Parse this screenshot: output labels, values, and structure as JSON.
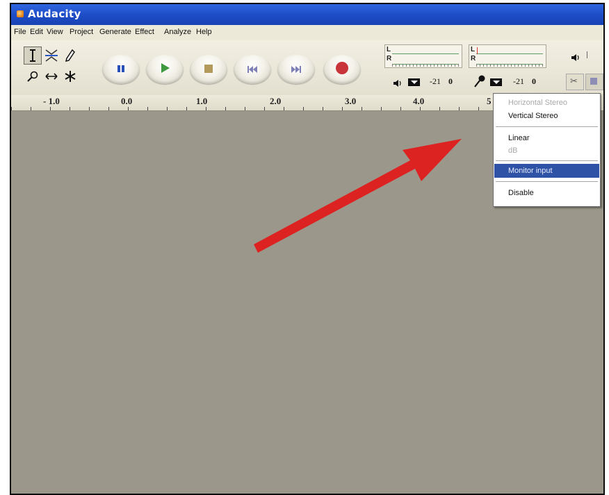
{
  "window": {
    "title": "Audacity"
  },
  "menubar": {
    "items": [
      "File",
      "Edit",
      "View",
      "Project",
      "Generate",
      "Effect",
      "Analyze",
      "Help"
    ]
  },
  "tools": {
    "selection": "selection-tool",
    "envelope": "envelope-tool",
    "draw": "draw-tool",
    "zoom": "zoom-tool",
    "timeshift": "time-shift-tool",
    "multi": "multi-tool"
  },
  "transport": [
    "pause",
    "play",
    "stop",
    "skip-to-start",
    "skip-to-end",
    "record"
  ],
  "meters": {
    "play": {
      "left": "L",
      "right": "R",
      "min": "-21",
      "max": "0"
    },
    "record": {
      "left": "L",
      "right": "R",
      "min": "-21",
      "max": "0"
    }
  },
  "ruler": {
    "labels": [
      "- 1.0",
      "0.0",
      "1.0",
      "2.0",
      "3.0",
      "4.0",
      "5"
    ]
  },
  "meter_menu": {
    "items": [
      {
        "label": "Horizontal Stereo",
        "state": "disabled"
      },
      {
        "label": "Vertical Stereo",
        "state": "enabled"
      },
      {
        "label": "Linear",
        "state": "enabled"
      },
      {
        "label": "dB",
        "state": "disabled"
      },
      {
        "label": "Monitor input",
        "state": "highlighted"
      },
      {
        "label": "Disable",
        "state": "enabled"
      }
    ]
  },
  "colors": {
    "titlebar": "#1c4cc6",
    "track_bg": "#9b978a",
    "arrow": "#dd2222",
    "highlight": "#2d52a6"
  }
}
